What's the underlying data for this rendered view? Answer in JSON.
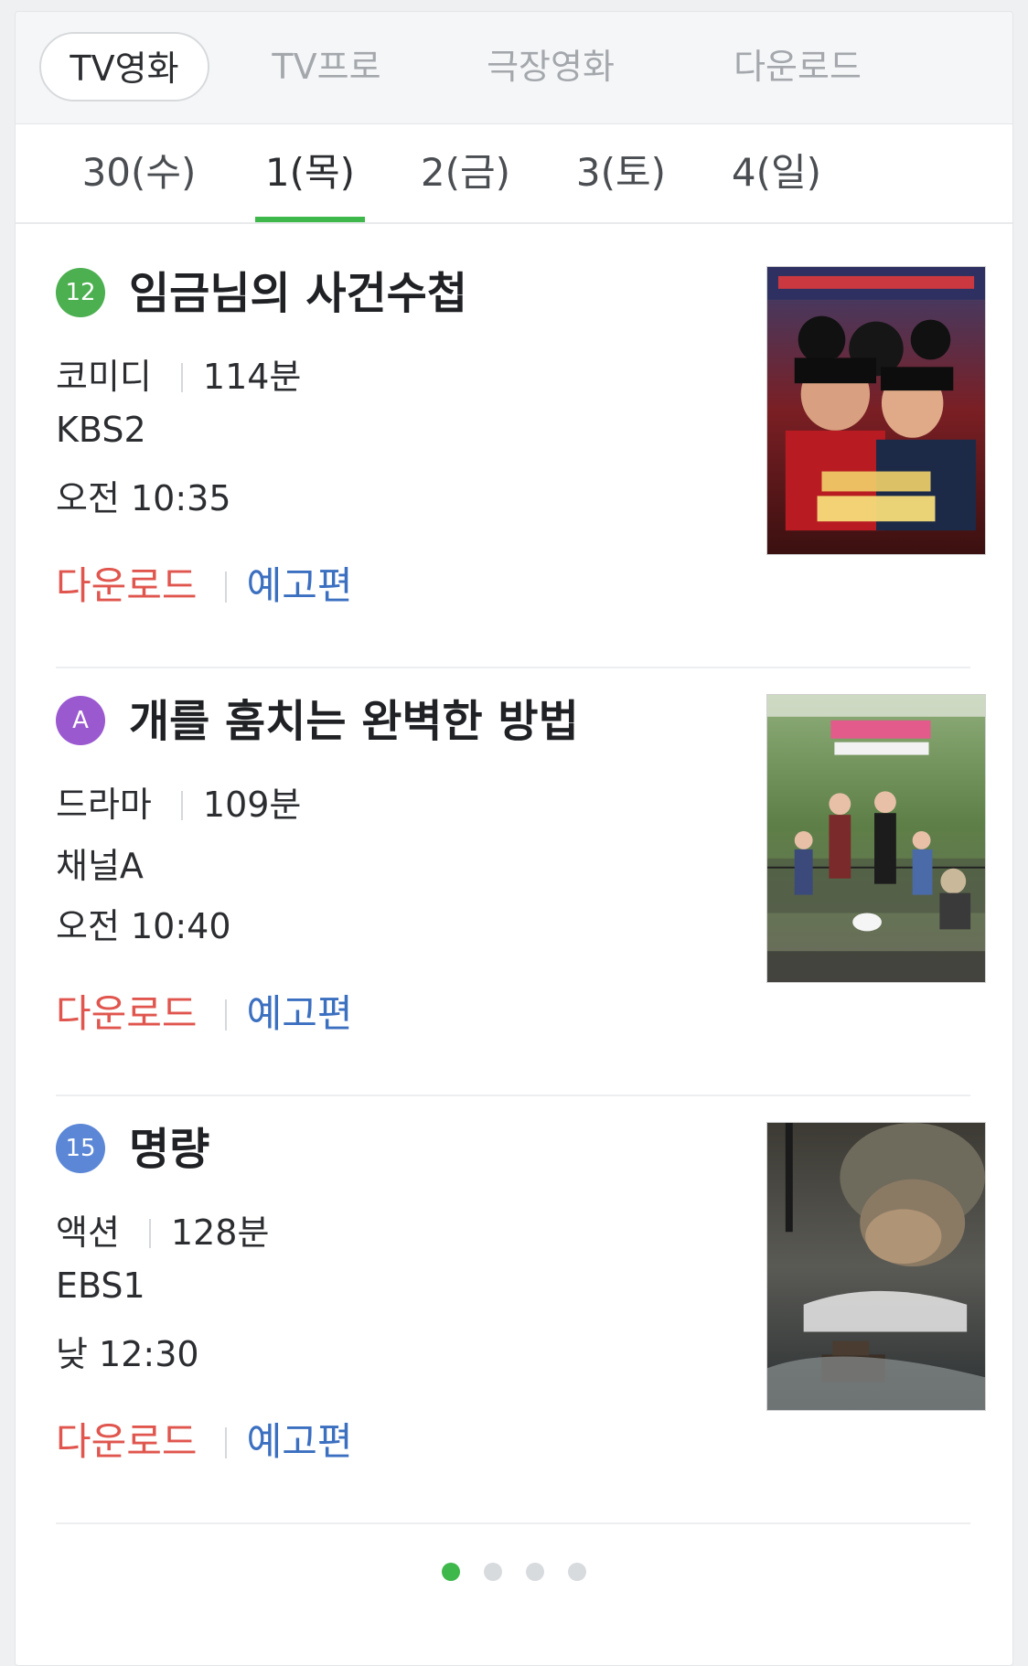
{
  "category_tabs": [
    {
      "label": "TV영화",
      "active": true
    },
    {
      "label": "TV프로",
      "active": false
    },
    {
      "label": "극장영화",
      "active": false
    },
    {
      "label": "다운로드",
      "active": false
    }
  ],
  "date_tabs": [
    {
      "label": "30(수)",
      "active": false
    },
    {
      "label": "1(목)",
      "active": true
    },
    {
      "label": "2(금)",
      "active": false
    },
    {
      "label": "3(토)",
      "active": false
    },
    {
      "label": "4(일)",
      "active": false
    }
  ],
  "movies": [
    {
      "rating": "12",
      "rating_color": "#4caf50",
      "title": "임금님의 사건수첩",
      "genre": "코미디",
      "runtime": "114분",
      "channel": "KBS2",
      "time": "오전 10:35",
      "download_label": "다운로드",
      "trailer_label": "예고편",
      "poster_icon": "poster-image"
    },
    {
      "rating": "A",
      "rating_color": "#9b59d0",
      "title": "개를 훔치는 완벽한 방법",
      "genre": "드라마",
      "runtime": "109분",
      "channel": "채널A",
      "time": "오전 10:40",
      "download_label": "다운로드",
      "trailer_label": "예고편",
      "poster_icon": "poster-image"
    },
    {
      "rating": "15",
      "rating_color": "#5b87d6",
      "title": "명량",
      "genre": "액션",
      "runtime": "128분",
      "channel": "EBS1",
      "time": "낮 12:30",
      "download_label": "다운로드",
      "trailer_label": "예고편",
      "poster_icon": "poster-image"
    }
  ],
  "pagination": {
    "total": 4,
    "current": 1
  },
  "colors": {
    "accent_green": "#3fb84b",
    "download_red": "#e0564e",
    "trailer_blue": "#3b6fc0"
  }
}
